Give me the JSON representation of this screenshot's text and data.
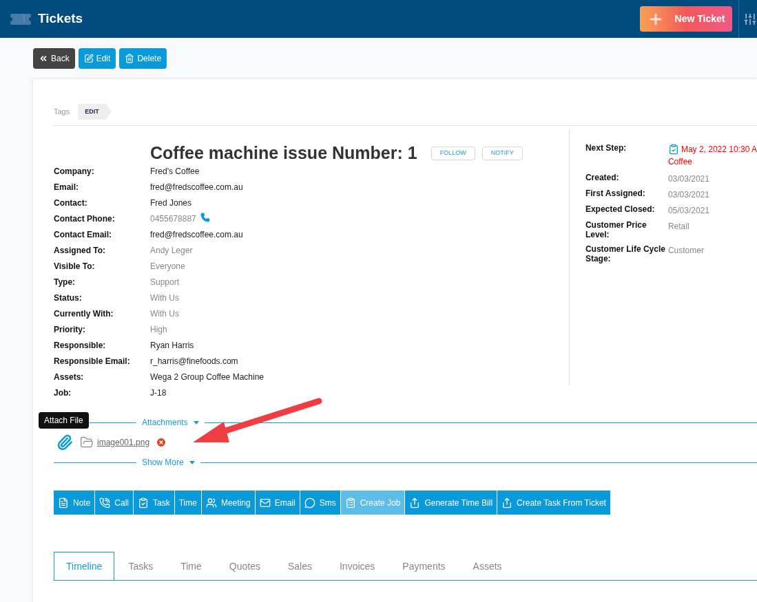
{
  "header": {
    "title": "Tickets",
    "new_button": "New Ticket"
  },
  "toolbar": [
    "Back",
    "Edit",
    "Delete"
  ],
  "tags": {
    "label": "Tags",
    "items": [
      "EDIT"
    ]
  },
  "ticket": {
    "title": "Coffee machine issue Number: 1",
    "buttons": [
      "FOLLOW",
      "NOTIFY"
    ]
  },
  "fields": [
    {
      "label": "Company:",
      "value": "Fred's Coffee",
      "kind": "link"
    },
    {
      "label": "Email:",
      "value": "fred@fredscoffee.com.au",
      "kind": "link"
    },
    {
      "label": "Contact:",
      "value": "Fred Jones",
      "kind": "link"
    },
    {
      "label": "Contact Phone:",
      "value": "0455678887",
      "kind": "phone"
    },
    {
      "label": "Contact Email:",
      "value": "fred@fredscoffee.com.au",
      "kind": "link"
    },
    {
      "label": "Assigned To:",
      "value": "Andy Leger",
      "kind": "text"
    },
    {
      "label": "Visible To:",
      "value": "Everyone",
      "kind": "text"
    },
    {
      "label": "Type:",
      "value": "Support",
      "kind": "text"
    },
    {
      "label": "Status:",
      "value": "With Us",
      "kind": "text"
    },
    {
      "label": "Currently With:",
      "value": "With Us",
      "kind": "text"
    },
    {
      "label": "Priority:",
      "value": "High",
      "kind": "text"
    },
    {
      "label": "Responsible:",
      "value": "Ryan Harris",
      "kind": "link"
    },
    {
      "label": "Responsible Email:",
      "value": "r_harris@finefoods.com",
      "kind": "link"
    },
    {
      "label": "Assets:",
      "value": "Wega 2 Group Coffee Machine",
      "kind": "link"
    },
    {
      "label": "Job:",
      "value": "J-18",
      "kind": "link"
    }
  ],
  "side_fields": [
    {
      "label": "Next Step:",
      "value": "May 2, 2022 10:30 A",
      "value_line2": "Coffee",
      "kind": "next_step"
    },
    {
      "label": "Created:",
      "value": "03/03/2021",
      "kind": "text"
    },
    {
      "label": "First Assigned:",
      "value": "03/03/2021",
      "kind": "text"
    },
    {
      "label": "Expected Closed:",
      "value": "05/03/2021",
      "kind": "text"
    },
    {
      "label": "Customer Price Level:",
      "value": "Retail",
      "kind": "text"
    },
    {
      "label": "Customer Life Cycle Stage:",
      "value": "Customer",
      "kind": "text"
    }
  ],
  "attachments": {
    "label": "Attachments",
    "tooltip": "Attach File",
    "files": [
      "image001.png"
    ]
  },
  "show_more": "Show More",
  "actions": [
    {
      "label": "Note",
      "kind": "note",
      "disabled": false
    },
    {
      "label": "Call",
      "kind": "call",
      "disabled": false
    },
    {
      "label": "Task",
      "kind": "task",
      "disabled": false
    },
    {
      "label": "Time",
      "kind": "time",
      "disabled": false
    },
    {
      "label": "Meeting",
      "kind": "meeting",
      "disabled": false
    },
    {
      "label": "Email",
      "kind": "email",
      "disabled": false
    },
    {
      "label": "Sms",
      "kind": "sms",
      "disabled": false
    },
    {
      "label": "Create Job",
      "kind": "job",
      "disabled": true
    },
    {
      "label": "Generate Time Bill",
      "kind": "bill",
      "disabled": false
    },
    {
      "label": "Create Task From Ticket",
      "kind": "convert",
      "disabled": false
    }
  ],
  "tabs": [
    {
      "label": "Timeline",
      "selected": true
    },
    {
      "label": "Tasks",
      "selected": false
    },
    {
      "label": "Time",
      "selected": false
    },
    {
      "label": "Quotes",
      "selected": false
    },
    {
      "label": "Sales",
      "selected": false
    },
    {
      "label": "Invoices",
      "selected": false
    },
    {
      "label": "Payments",
      "selected": false
    },
    {
      "label": "Assets",
      "selected": false
    }
  ]
}
